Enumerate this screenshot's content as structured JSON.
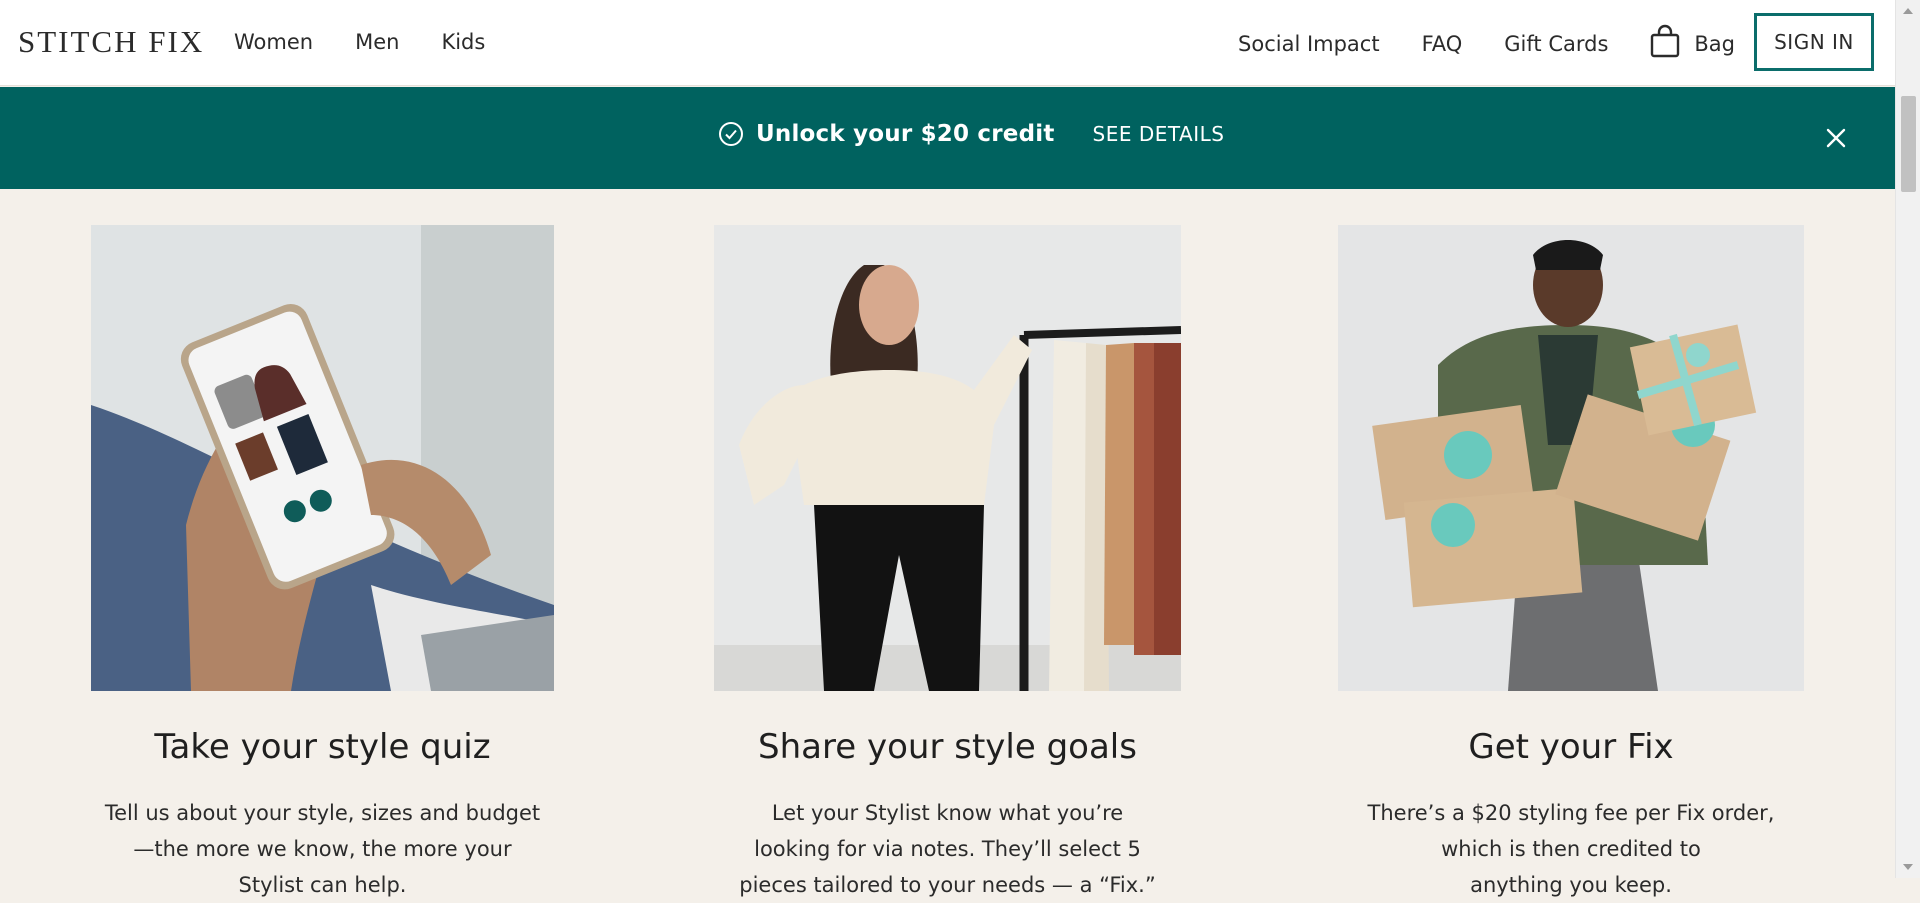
{
  "header": {
    "logo": "STITCH FIX",
    "nav_left": [
      "Women",
      "Men",
      "Kids"
    ],
    "nav_right": [
      "Social Impact",
      "FAQ",
      "Gift Cards"
    ],
    "bag_label": "Bag",
    "sign_in": "SIGN IN"
  },
  "promo": {
    "text": "Unlock your $20 credit",
    "link": "SEE DETAILS"
  },
  "steps": [
    {
      "title": "Take your style quiz",
      "body": "Tell us about your style, sizes and budget\n—the more we know, the more your\nStylist can help."
    },
    {
      "title": "Share your style goals",
      "body": "Let your Stylist know what you’re\nlooking for via notes. They’ll select 5\npieces tailored to your needs — a “Fix.”"
    },
    {
      "title": "Get your Fix",
      "body": "There’s a $20 styling fee per Fix order,\nwhich is then credited to\nanything you keep."
    }
  ],
  "colors": {
    "brand_teal": "#00625f",
    "sign_in_border": "#0b6d6b",
    "page_bg": "#f4f0ea"
  },
  "icons": [
    "bag-icon",
    "check-circle-icon",
    "close-icon"
  ]
}
